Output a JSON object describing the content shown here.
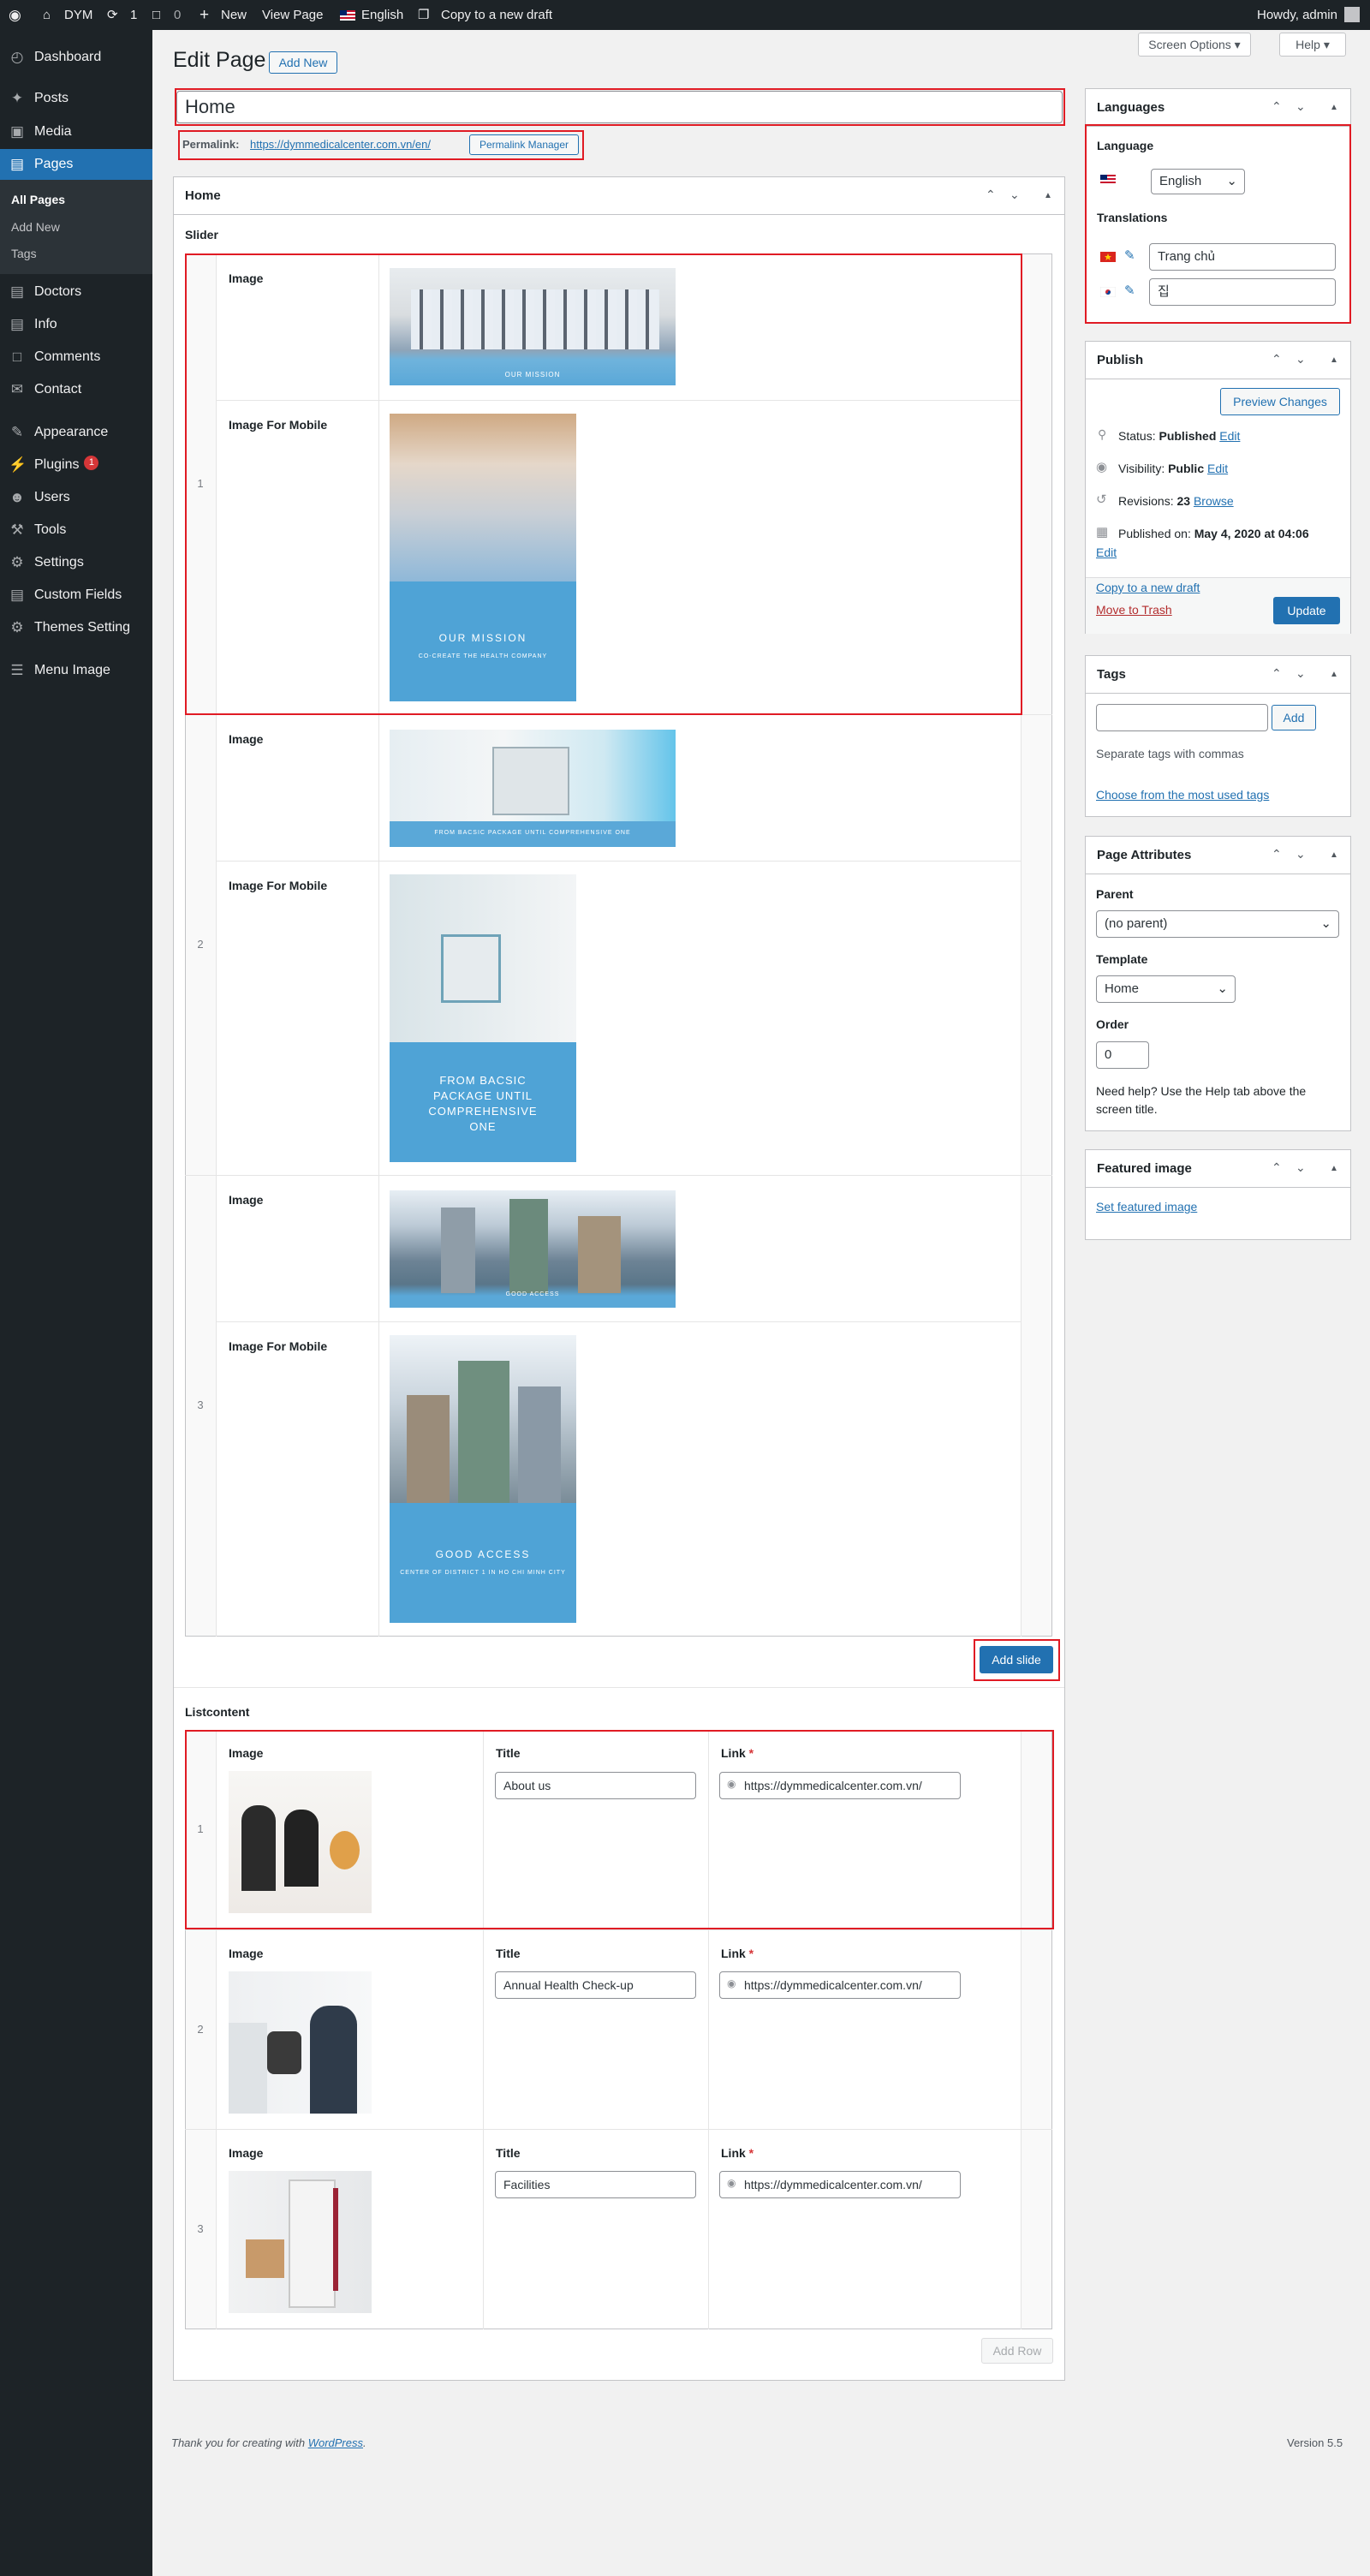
{
  "adminbar": {
    "site_name": "DYM",
    "updates_count": "1",
    "comments_count": "0",
    "new_label": "New",
    "view_page_label": "View Page",
    "language_label": "English",
    "copy_draft_label": "Copy to a new draft",
    "howdy": "Howdy, admin"
  },
  "sidebar": {
    "dashboard": "Dashboard",
    "posts": "Posts",
    "media": "Media",
    "pages": "Pages",
    "all_pages": "All Pages",
    "add_new": "Add New",
    "tags": "Tags",
    "doctors": "Doctors",
    "info": "Info",
    "comments": "Comments",
    "contact": "Contact",
    "appearance": "Appearance",
    "plugins": "Plugins",
    "plugins_badge": "1",
    "users": "Users",
    "tools": "Tools",
    "settings": "Settings",
    "custom_fields": "Custom Fields",
    "themes_setting": "Themes Setting",
    "menu_image": "Menu Image"
  },
  "screen": {
    "screen_options": "Screen Options",
    "help": "Help"
  },
  "page": {
    "heading": "Edit Page",
    "add_new": "Add New",
    "title_value": "Home",
    "permalink_label": "Permalink:",
    "permalink_url": "https://dymmedicalcenter.com.vn/en/",
    "permalink_manager": "Permalink Manager"
  },
  "home_box": {
    "title": "Home",
    "slider_label": "Slider",
    "image_label": "Image",
    "image_mobile_label": "Image For Mobile",
    "slides": [
      {
        "num": "1",
        "desktop_caption": "OUR MISSION",
        "mobile_caption": "OUR MISSION",
        "mobile_sub": "CO-CREATE THE HEALTH COMPANY"
      },
      {
        "num": "2",
        "desktop_caption": "FROM BACSIC PACKAGE UNTIL COMPREHENSIVE ONE",
        "mobile_caption": "FROM BACSIC PACKAGE UNTIL COMPREHENSIVE ONE",
        "mobile_sub": ""
      },
      {
        "num": "3",
        "desktop_caption": "GOOD ACCESS",
        "mobile_caption": "GOOD ACCESS",
        "mobile_sub": "CENTER OF DISTRICT 1 IN HO CHI MINH CITY"
      }
    ],
    "add_slide": "Add slide",
    "listcontent_label": "Listcontent",
    "col_image": "Image",
    "col_title": "Title",
    "col_link": "Link",
    "required_mark": "*",
    "rows": [
      {
        "num": "1",
        "title": "About us",
        "link": "https://dymmedicalcenter.com.vn/"
      },
      {
        "num": "2",
        "title": "Annual Health Check-up",
        "link": "https://dymmedicalcenter.com.vn/"
      },
      {
        "num": "3",
        "title": "Facilities",
        "link": "https://dymmedicalcenter.com.vn/"
      }
    ],
    "add_row": "Add Row"
  },
  "languages_box": {
    "title": "Languages",
    "language_label": "Language",
    "language_value": "English",
    "translations_label": "Translations",
    "translation_vi": "Trang chủ",
    "translation_ko": "집"
  },
  "publish_box": {
    "title": "Publish",
    "preview": "Preview Changes",
    "status_label": "Status:",
    "status_value": "Published",
    "visibility_label": "Visibility:",
    "visibility_value": "Public",
    "revisions_label": "Revisions:",
    "revisions_value": "23",
    "browse": "Browse",
    "published_on_label": "Published on:",
    "published_on_value": "May 4, 2020 at 04:06",
    "edit": "Edit",
    "copy_draft": "Copy to a new draft",
    "trash": "Move to Trash",
    "update": "Update"
  },
  "tags_box": {
    "title": "Tags",
    "add": "Add",
    "hint": "Separate tags with commas",
    "choose": "Choose from the most used tags"
  },
  "attributes_box": {
    "title": "Page Attributes",
    "parent_label": "Parent",
    "parent_value": "(no parent)",
    "template_label": "Template",
    "template_value": "Home",
    "order_label": "Order",
    "order_value": "0",
    "help_text_1": "Need help? Use the Help tab above the",
    "help_text_2": "screen title."
  },
  "featured_box": {
    "title": "Featured image",
    "set_link": "Set featured image"
  },
  "footer": {
    "thanks": "Thank you for creating with",
    "wordpress": "WordPress",
    "version": "Version 5.5"
  },
  "colors": {
    "accent": "#2271b1",
    "highlight": "#e01b24",
    "adminbar": "#1d2327",
    "slide_blue": "#4fa3d6"
  }
}
